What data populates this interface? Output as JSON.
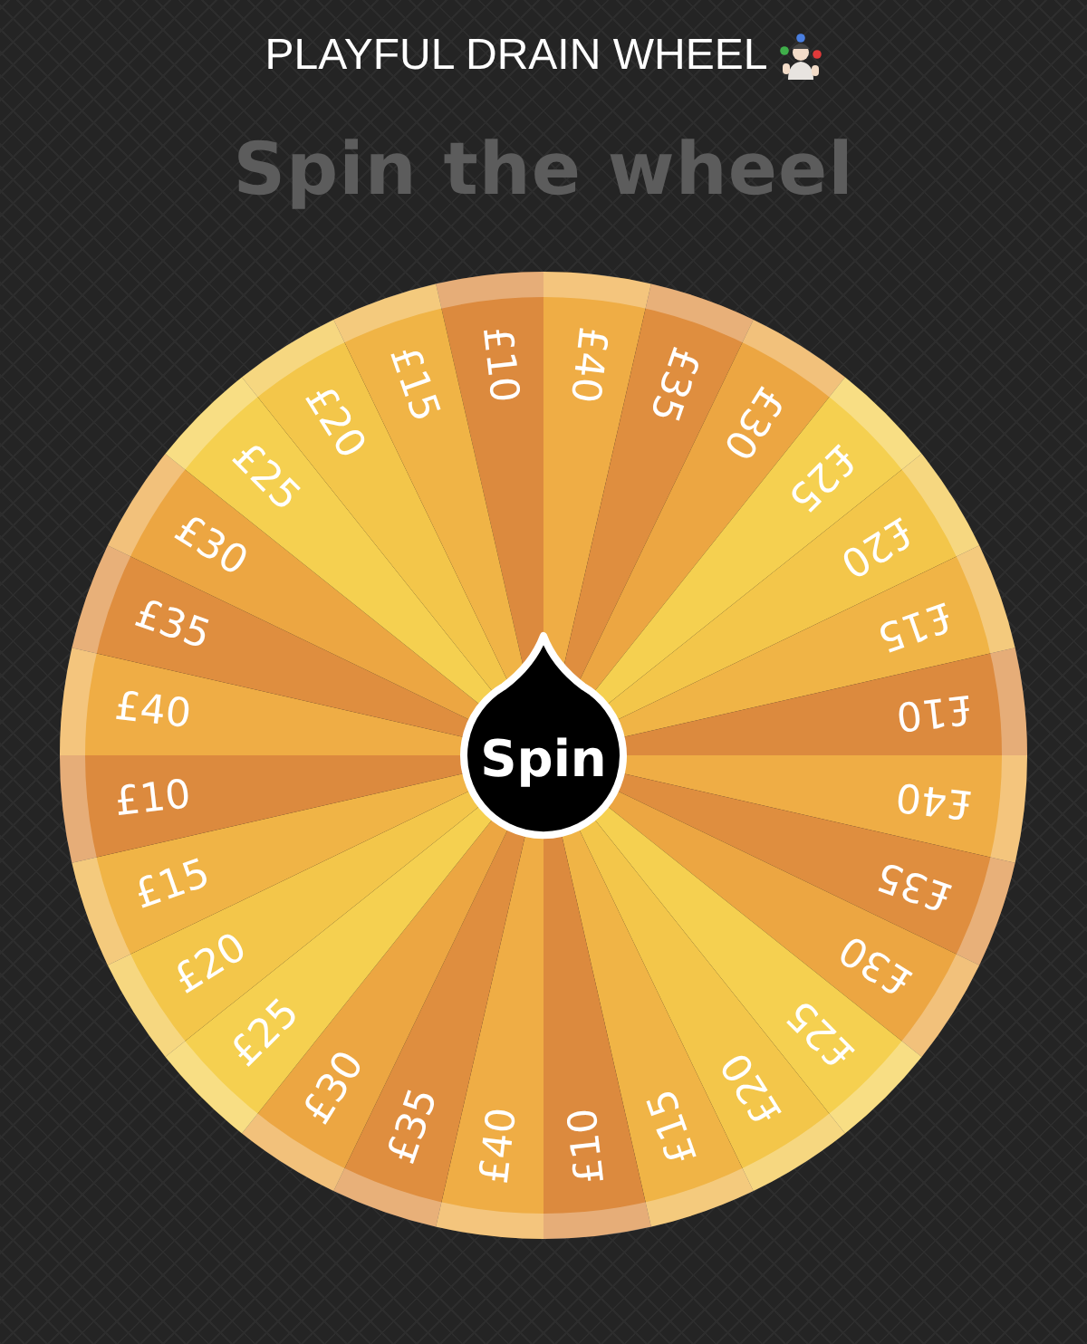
{
  "title": "PLAYFUL DRAIN WHEEL",
  "heading": "Spin the wheel",
  "wheel": {
    "segments": [
      {
        "label": "£10"
      },
      {
        "label": "£40"
      },
      {
        "label": "£35"
      },
      {
        "label": "£30"
      },
      {
        "label": "£25"
      },
      {
        "label": "£20"
      },
      {
        "label": "£15"
      },
      {
        "label": "£10"
      },
      {
        "label": "£40"
      },
      {
        "label": "£35"
      },
      {
        "label": "£30"
      },
      {
        "label": "£25"
      },
      {
        "label": "£20"
      },
      {
        "label": "£15"
      },
      {
        "label": "£10"
      },
      {
        "label": "£40"
      },
      {
        "label": "£35"
      },
      {
        "label": "£30"
      },
      {
        "label": "£25"
      },
      {
        "label": "£20"
      },
      {
        "label": "£15"
      },
      {
        "label": "£10"
      },
      {
        "label": "£40"
      },
      {
        "label": "£35"
      },
      {
        "label": "£30"
      },
      {
        "label": "£25"
      },
      {
        "label": "£20"
      },
      {
        "label": "£15"
      }
    ],
    "button": "Spin"
  }
}
